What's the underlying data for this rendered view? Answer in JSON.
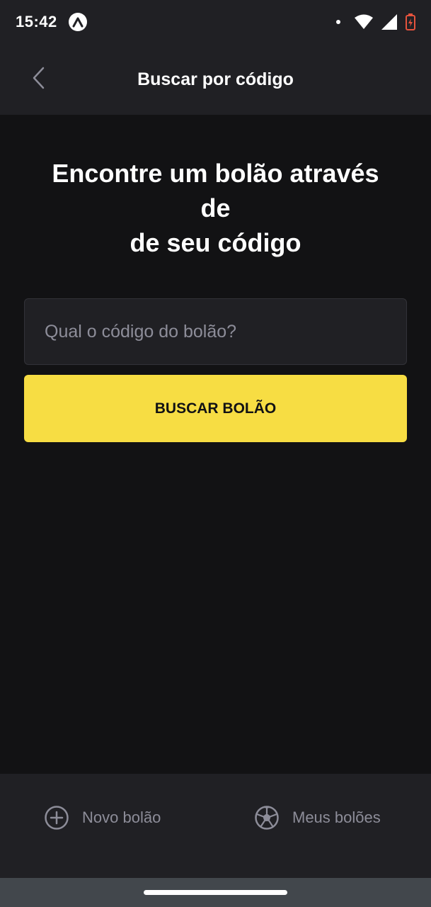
{
  "status_bar": {
    "time": "15:42",
    "icons": [
      "expo-icon",
      "notification-dot-icon",
      "wifi-icon",
      "signal-icon",
      "battery-charging-icon"
    ]
  },
  "header": {
    "title": "Buscar por código",
    "back_icon": "chevron-left-icon"
  },
  "main": {
    "headline_lines": [
      "Encontre um bolão através",
      "de",
      "de seu código"
    ],
    "search": {
      "placeholder": "Qual o código do bolão?",
      "value": ""
    },
    "button_label": "BUSCAR BOLÃO"
  },
  "tab_bar": {
    "items": [
      {
        "label": "Novo bolão",
        "icon": "plus-circle-icon"
      },
      {
        "label": "Meus bolões",
        "icon": "soccer-ball-icon"
      }
    ]
  },
  "colors": {
    "background": "#121214",
    "surface": "#202024",
    "accent": "#f7dd43",
    "muted_text": "#8d8d99",
    "battery": "#e5533d"
  }
}
